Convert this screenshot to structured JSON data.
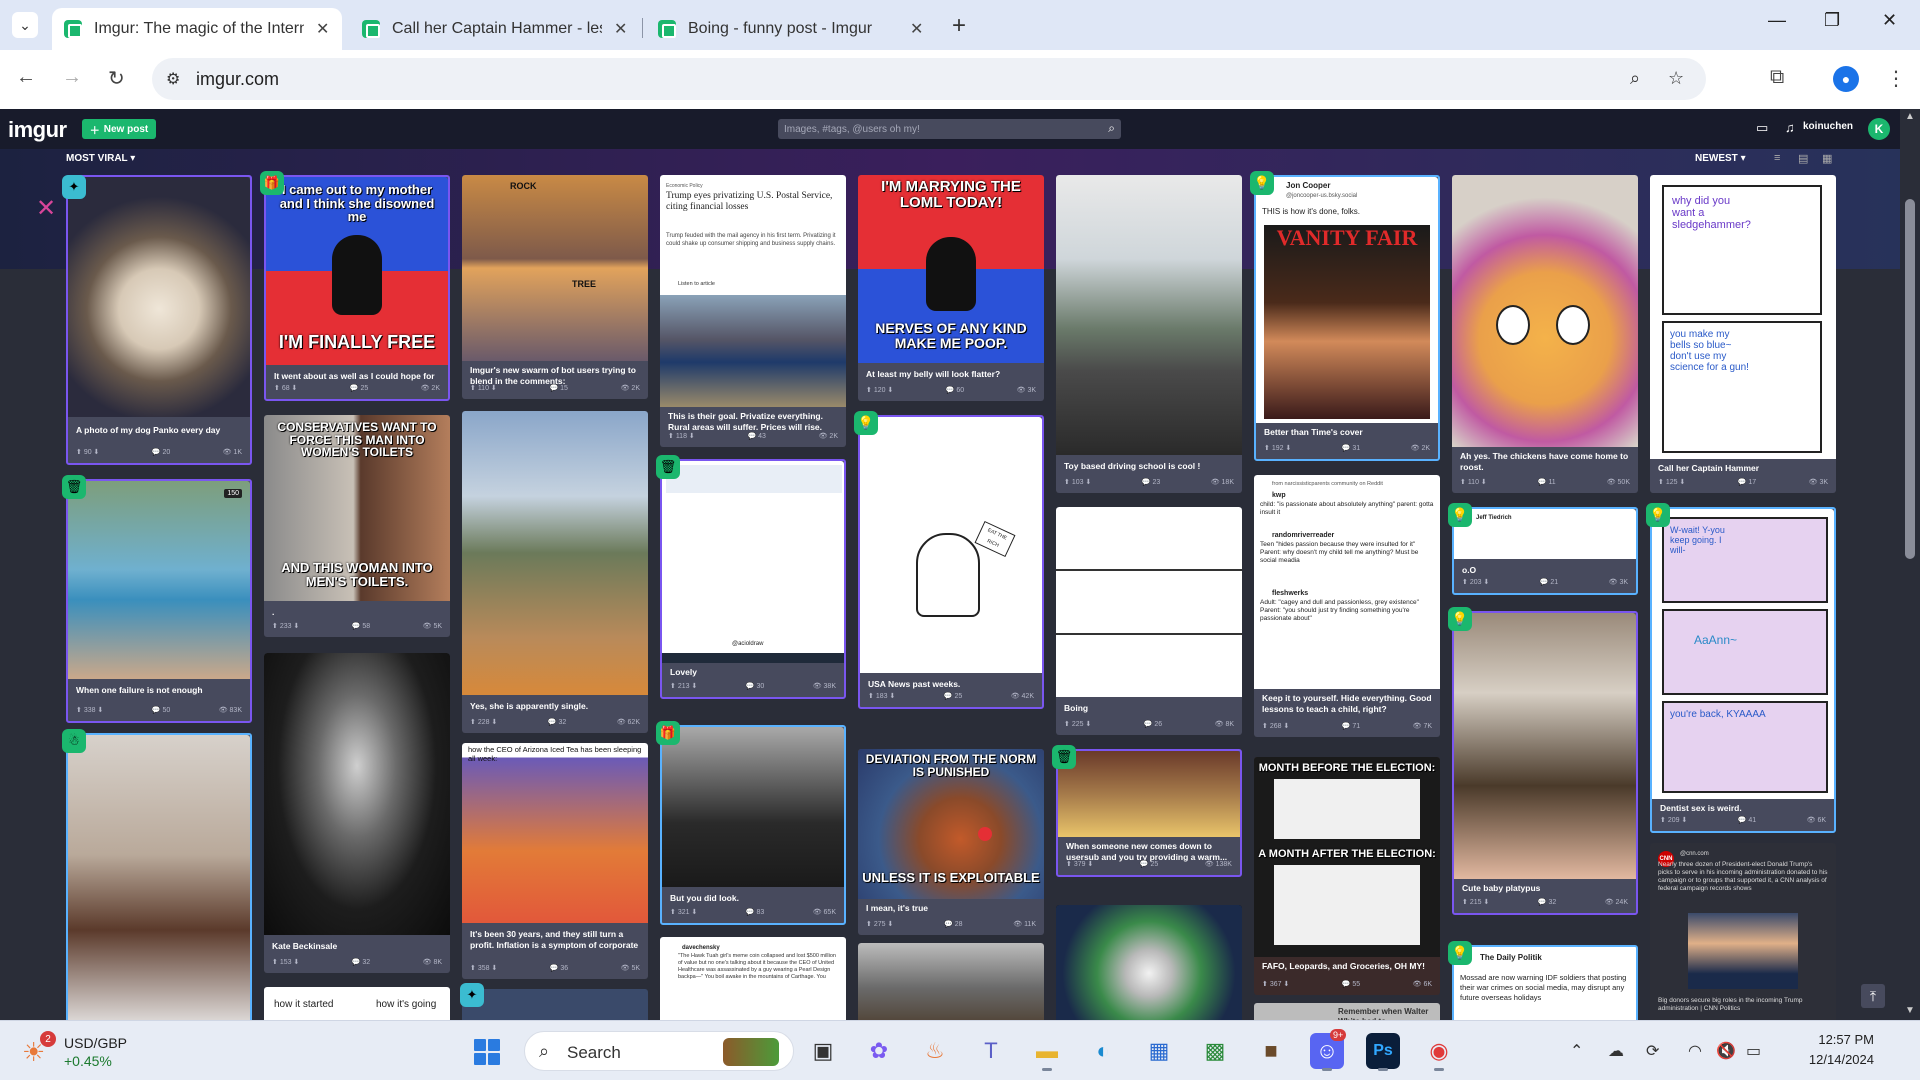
{
  "browser": {
    "tabs": [
      {
        "label": "Imgur: The magic of the Interne",
        "active": true
      },
      {
        "label": "Call her Captain Hammer - lesb",
        "active": false
      },
      {
        "label": "Boing - funny post - Imgur",
        "active": false
      }
    ],
    "new_tab": "+",
    "url": "imgur.com",
    "window_controls": {
      "minimize": "—",
      "restore": "❐",
      "close": "✕"
    }
  },
  "imgur": {
    "logo": "imgur",
    "new_post": "New post",
    "search_placeholder": "Images, #tags, @users oh my!",
    "username": "koinuchen",
    "user_initial": "K",
    "sort_left": "MOST VIRAL",
    "sort_right": "NEWEST"
  },
  "posts": [
    {
      "title": "A photo of my dog Panko every day",
      "ups": "90",
      "comments": "20",
      "views": "1K"
    },
    {
      "title": "When one failure is not enough",
      "ups": "338",
      "comments": "50",
      "views": "83K",
      "badge": "150"
    },
    {
      "title": "It went about as well as I could hope for",
      "ups": "68",
      "comments": "25",
      "views": "2K",
      "cap_top": "I came out to my mother and I think she disowned me",
      "cap_bottom": "I'M FINALLY FREE"
    },
    {
      "title": ".",
      "ups": "233",
      "comments": "58",
      "views": "5K",
      "cap_top": "CONSERVATIVES WANT TO FORCE THIS MAN INTO WOMEN'S TOILETS",
      "cap_bottom": "AND THIS WOMAN INTO MEN'S TOILETS."
    },
    {
      "title": "Kate Beckinsale",
      "ups": "153",
      "comments": "32",
      "views": "8K"
    },
    {
      "title": "Imgur's new swarm of bot users trying to blend in the comments:",
      "ups": "110",
      "comments": "15",
      "views": "2K",
      "label_a": "ROCK",
      "label_b": "TREE"
    },
    {
      "title": "Yes, she is apparently single.",
      "ups": "228",
      "comments": "32",
      "views": "62K"
    },
    {
      "title": "It's been 30 years, and they still turn a profit. Inflation is a symptom of corporate greed.",
      "ups": "358",
      "comments": "36",
      "views": "5K",
      "header": "how the CEO of Arizona Iced Tea has been sleeping all week:"
    },
    {
      "title": "This is their goal. Privatize everything. Rural areas will suffer. Prices will rise.",
      "ups": "118",
      "comments": "43",
      "views": "2K",
      "kicker": "Economic Policy",
      "headline": "Trump eyes privatizing U.S. Postal Service, citing financial losses",
      "body": "Trump feuded with the mail agency in his first term. Privatizing it could shake up consumer shipping and business supply chains.",
      "listen": "Listen to article"
    },
    {
      "title": "Lovely",
      "ups": "213",
      "comments": "30",
      "views": "38K",
      "handle": "@acioldraw"
    },
    {
      "title": "But you did look.",
      "ups": "321",
      "comments": "83",
      "views": "65K"
    },
    {
      "title": "At least my belly will look flatter?",
      "ups": "120",
      "comments": "60",
      "views": "3K",
      "cap_top": "I'M MARRYING THE LOML TODAY!",
      "cap_bottom": "NERVES OF ANY KIND MAKE ME POOP."
    },
    {
      "title": "USA News past weeks.",
      "ups": "183",
      "comments": "25",
      "views": "42K",
      "sign": "EAT THE RICH"
    },
    {
      "title": "I mean, it's true",
      "ups": "275",
      "comments": "28",
      "views": "11K",
      "cap_top": "DEVIATION FROM THE NORM IS PUNISHED",
      "cap_bottom": "UNLESS IT IS EXPLOITABLE"
    },
    {
      "title": "Toy based driving school is cool !",
      "ups": "103",
      "comments": "23",
      "views": "18K"
    },
    {
      "title": "Boing",
      "ups": "225",
      "comments": "26",
      "views": "8K"
    },
    {
      "title": "When someone new comes down to usersub and you try providing a warm...",
      "ups": "379",
      "comments": "25",
      "views": "138K"
    },
    {
      "title": "Better than Time's cover",
      "ups": "192",
      "comments": "31",
      "views": "2K",
      "author": "Jon Cooper",
      "handle": "@joncooper-us.bsky.social",
      "tweet": "THIS is how it's done, folks.",
      "mag": "VANITY FAIR"
    },
    {
      "title": "Keep it to yourself. Hide everything. Good lessons to teach a child, right?",
      "ups": "268",
      "comments": "71",
      "views": "7K",
      "source": "from narcissisticparents community on Reddit",
      "u1": "kwp",
      "t1": "child: \"is passionate about absolutely anything\" parent: gotta insult it",
      "u2": "randomriverreader",
      "t2": "Teen \"hides passion because they were insulted for it\" Parent: why doesn't my child tell me anything? Must be social meadia",
      "u3": "fleshwerks",
      "t3": "Adult: \"cagey and dull and passionless, grey existence\" Parent: \"you should just try finding something you're passionate about\""
    },
    {
      "title": "FAFO, Leopards, and Groceries, OH MY!",
      "ups": "367",
      "comments": "55",
      "views": "6K",
      "h1": "MONTH BEFORE THE ELECTION:",
      "h2": "A MONTH AFTER THE ELECTION:"
    },
    {
      "title": "Ah yes. The chickens have come home to roost.",
      "ups": "110",
      "comments": "11",
      "views": "50K"
    },
    {
      "title": "o.O",
      "ups": "203",
      "comments": "21",
      "views": "3K",
      "author": "Jeff Tiedrich"
    },
    {
      "title": "Cute baby platypus",
      "ups": "215",
      "comments": "32",
      "views": "24K"
    },
    {
      "title": "Call her Captain Hammer",
      "ups": "125",
      "comments": "17",
      "views": "3K",
      "c1": "why did you want a sledgehammer?",
      "c2": "you make my bells so blue~ don't use my science for a gun!"
    },
    {
      "title": "Dentist sex is weird.",
      "ups": "209",
      "comments": "41",
      "views": "6K",
      "c1": "W-wait! Y-you keep going. I will-",
      "c2": "AaAnn~",
      "c3": "you're back, KYAAAA"
    },
    {
      "author": "The Daily Politik",
      "text": "Mossad are now warning IDF soldiers that posting their war crimes on social media, may disrupt any future overseas holidays"
    },
    {
      "author": "CNN",
      "handle": "@cnn.com",
      "text": "Nearly three dozen of President-elect Donald Trump's picks to serve in his incoming administration donated to his campaign or to groups that supported it, a CNN analysis of federal campaign records shows",
      "caption": "Big donors secure big roles in the incoming Trump administration | CNN Politics"
    },
    {
      "left": "how it started",
      "right": "how it's going"
    },
    {
      "author": "davechensky",
      "text": "\"The Hawk Tuah girl's meme coin collapsed and lost $500 million of value but no one's talking about it because the CEO of United Healthcare was assassinated by a guy wearing a Pearl Design backpa—\" You boil awake in the mountains of Carthage. You"
    },
    {
      "caption": "Remember when Walter White had to"
    }
  ],
  "taskbar": {
    "ticker": "USD/GBP",
    "change": "+0.45%",
    "notif": "2",
    "search": "Search",
    "time": "12:57 PM",
    "date": "12/14/2024",
    "discord_badge": "9+"
  },
  "colors": {
    "accent": "#1bb76e",
    "promo_border": "#7a56f0",
    "card_bg": "#474a5d",
    "page_bg": "#2a2d38"
  }
}
